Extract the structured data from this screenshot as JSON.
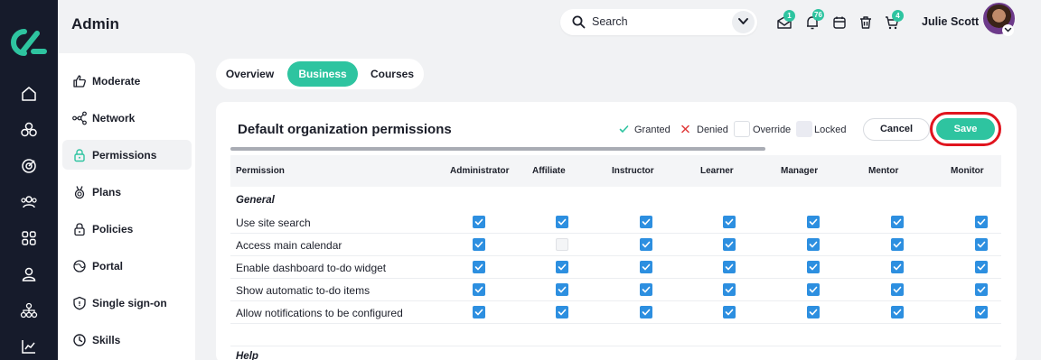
{
  "app": {
    "logo_icon": "brand-logo-icon",
    "accent_color": "#2ec4a0",
    "rail_color": "#161b2b"
  },
  "rail": {
    "items": [
      {
        "icon": "home-icon"
      },
      {
        "icon": "cluster-icon"
      },
      {
        "icon": "target-icon"
      },
      {
        "icon": "users-icon"
      },
      {
        "icon": "grid-icon"
      },
      {
        "icon": "person-icon"
      },
      {
        "icon": "hierarchy-icon"
      },
      {
        "icon": "chart-icon"
      }
    ]
  },
  "header": {
    "title": "Admin",
    "search_placeholder": "Search",
    "user_name": "Julie Scott",
    "icons": [
      {
        "name": "inbox-icon",
        "badge": "1"
      },
      {
        "name": "bell-icon",
        "badge": "76"
      },
      {
        "name": "calendar-icon",
        "badge": ""
      },
      {
        "name": "trash-icon",
        "badge": ""
      },
      {
        "name": "cart-icon",
        "badge": "4"
      }
    ]
  },
  "subnav": {
    "items": [
      {
        "label": "Moderate",
        "icon": "thumbs-up-icon",
        "active": false
      },
      {
        "label": "Network",
        "icon": "network-icon",
        "active": false
      },
      {
        "label": "Permissions",
        "icon": "lock-icon",
        "active": true
      },
      {
        "label": "Plans",
        "icon": "medal-icon",
        "active": false
      },
      {
        "label": "Policies",
        "icon": "padlock-icon",
        "active": false
      },
      {
        "label": "Portal",
        "icon": "globe-icon",
        "active": false
      },
      {
        "label": "Single sign-on",
        "icon": "shield-icon",
        "active": false
      },
      {
        "label": "Skills",
        "icon": "clock-icon",
        "active": false
      }
    ]
  },
  "tabs": [
    {
      "label": "Overview",
      "active": false
    },
    {
      "label": "Business",
      "active": true
    },
    {
      "label": "Courses",
      "active": false
    }
  ],
  "card": {
    "title": "Default organization permissions",
    "legend": {
      "granted": "Granted",
      "denied": "Denied",
      "override": "Override",
      "locked": "Locked"
    },
    "cancel_label": "Cancel",
    "save_label": "Save"
  },
  "table": {
    "columns": [
      "Permission",
      "Administrator",
      "Affiliate",
      "Instructor",
      "Learner",
      "Manager",
      "Mentor",
      "Monitor"
    ],
    "sections": [
      {
        "label": "General",
        "rows": [
          {
            "name": "Use site search",
            "values": [
              true,
              true,
              true,
              true,
              true,
              true,
              true
            ]
          },
          {
            "name": "Access main calendar",
            "values": [
              true,
              false,
              true,
              true,
              true,
              true,
              true
            ]
          },
          {
            "name": "Enable dashboard to-do widget",
            "values": [
              true,
              true,
              true,
              true,
              true,
              true,
              true
            ]
          },
          {
            "name": "Show automatic to-do items",
            "values": [
              true,
              true,
              true,
              true,
              true,
              true,
              true
            ]
          },
          {
            "name": "Allow notifications to be configured",
            "values": [
              true,
              true,
              true,
              true,
              true,
              true,
              true
            ]
          }
        ]
      },
      {
        "label": "Help",
        "rows": []
      }
    ]
  }
}
